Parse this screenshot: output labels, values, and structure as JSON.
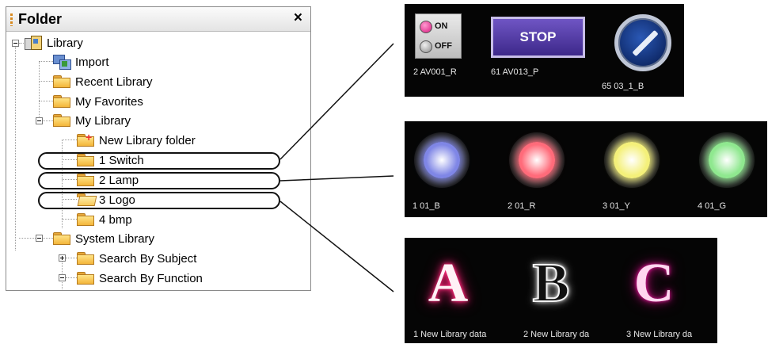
{
  "folder_panel": {
    "title": "Folder",
    "close_glyph": "×",
    "items": [
      {
        "label": "Library",
        "icon": "library-icon"
      },
      {
        "label": "Import",
        "icon": "import-icon"
      },
      {
        "label": "Recent Library",
        "icon": "folder-icon"
      },
      {
        "label": "My Favorites",
        "icon": "folder-icon"
      },
      {
        "label": "My Library",
        "icon": "folder-icon"
      },
      {
        "label": "New Library folder",
        "icon": "new-folder-icon"
      },
      {
        "label": "1 Switch",
        "icon": "folder-icon"
      },
      {
        "label": "2 Lamp",
        "icon": "folder-icon"
      },
      {
        "label": "3 Logo",
        "icon": "open-folder-icon"
      },
      {
        "label": "4 bmp",
        "icon": "folder-icon"
      },
      {
        "label": "System Library",
        "icon": "folder-icon"
      },
      {
        "label": "Search By Subject",
        "icon": "folder-icon"
      },
      {
        "label": "Search By Function",
        "icon": "folder-icon"
      }
    ]
  },
  "switch_preview": {
    "on_label": "ON",
    "off_label": "OFF",
    "stop_label": "STOP",
    "captions": [
      "2 AV001_R",
      "61 AV013_P",
      "65 03_1_B"
    ]
  },
  "lamp_preview": {
    "colors": [
      "#7f86e6",
      "#ff6b7a",
      "#f4f07a",
      "#8fe88f"
    ],
    "captions": [
      "1 01_B",
      "2 01_R",
      "3 01_Y",
      "4 01_G"
    ]
  },
  "logo_preview": {
    "letters": [
      "A",
      "B",
      "C"
    ],
    "captions": [
      "1 New Library data",
      "2 New Library da",
      "3 New Library da"
    ]
  }
}
